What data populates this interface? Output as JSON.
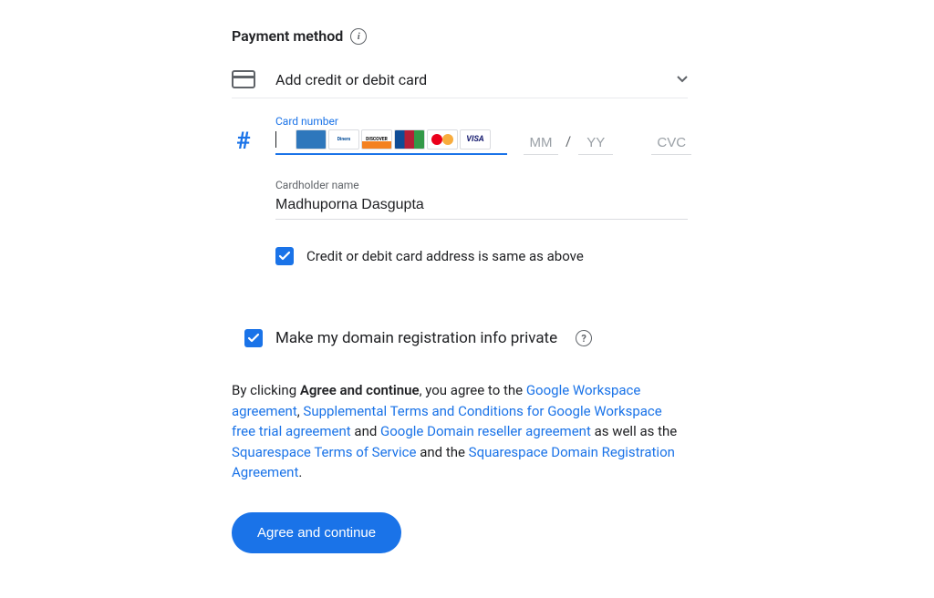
{
  "header": {
    "title": "Payment method"
  },
  "selector": {
    "label": "Add credit or debit card"
  },
  "card": {
    "number_label": "Card number",
    "number_value": "",
    "mm_placeholder": "MM",
    "yy_placeholder": "YY",
    "cvc_placeholder": "CVC",
    "logos": [
      "amex",
      "diners",
      "discover",
      "jcb",
      "mastercard",
      "visa"
    ]
  },
  "cardholder": {
    "label": "Cardholder name",
    "value": "Madhuporna Dasgupta"
  },
  "checkboxes": {
    "same_address": "Credit or debit card address is same as above",
    "domain_private": "Make my domain registration info private"
  },
  "legal": {
    "prefix": "By clicking ",
    "bold": "Agree and continue",
    "after_bold": ", you agree to the ",
    "link1": "Google Workspace agreement",
    "sep1": ", ",
    "link2": "Supplemental Terms and Conditions for Google Workspace free trial agreement",
    "sep2": " and ",
    "link3": "Google Domain reseller agreement",
    "sep3": " as well as the ",
    "link4": "Squarespace Terms of Service",
    "sep4": " and the ",
    "link5": "Squarespace Domain Registration Agreement",
    "suffix": "."
  },
  "button": {
    "label": "Agree and continue"
  }
}
